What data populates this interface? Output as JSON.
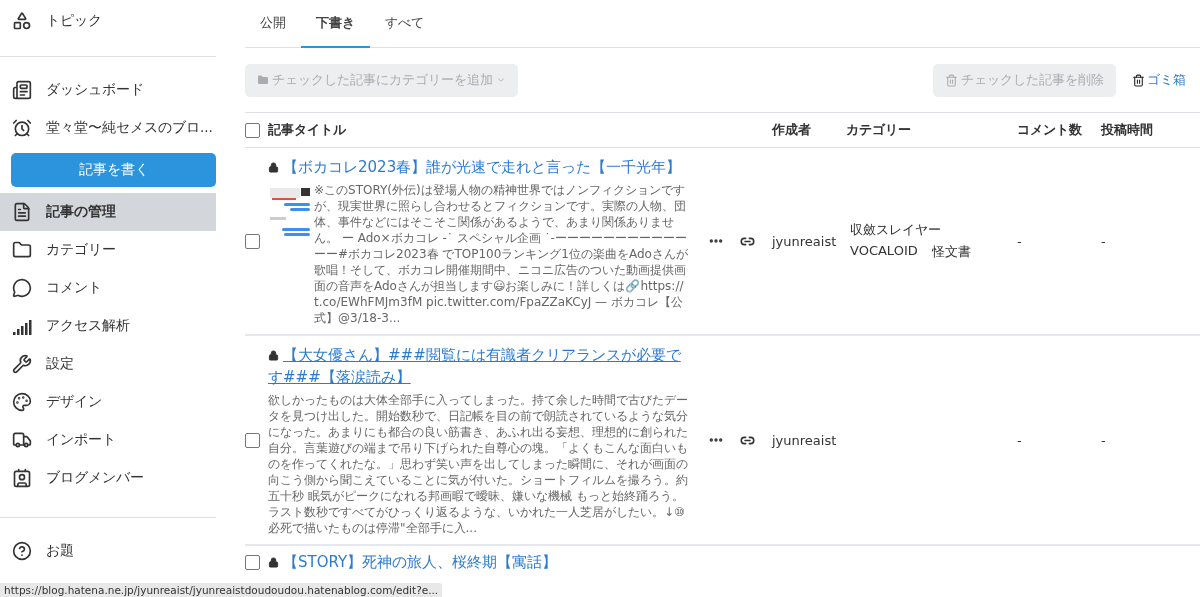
{
  "sidebar": {
    "top_items": [
      {
        "label": "トピック",
        "selected": false
      }
    ],
    "items": [
      {
        "label": "ダッシュボード",
        "selected": false
      },
      {
        "label": "堂々堂〜純セメスのブロ...",
        "selected": false
      }
    ],
    "write_button": "記事を書く",
    "manage_items": [
      {
        "label": "記事の管理",
        "selected": true
      },
      {
        "label": "カテゴリー",
        "selected": false
      },
      {
        "label": "コメント",
        "selected": false
      },
      {
        "label": "アクセス解析",
        "selected": false
      },
      {
        "label": "設定",
        "selected": false
      },
      {
        "label": "デザイン",
        "selected": false
      },
      {
        "label": "インポート",
        "selected": false
      },
      {
        "label": "ブログメンバー",
        "selected": false
      }
    ],
    "bottom_items": [
      {
        "label": "お題",
        "selected": false
      }
    ]
  },
  "tabs": [
    {
      "label": "公開",
      "selected": false
    },
    {
      "label": "下書き",
      "selected": true
    },
    {
      "label": "すべて",
      "selected": false
    }
  ],
  "toolbar": {
    "add_category": {
      "label": "チェックした記事にカテゴリーを追加",
      "disabled": true
    },
    "delete": {
      "label": "チェックした記事を削除",
      "disabled": true
    },
    "trash": "ゴミ箱"
  },
  "table": {
    "select_all": {
      "checked": false
    },
    "columns": [
      "記事タイトル",
      "作成者",
      "カテゴリー",
      "コメント数",
      "投稿時間"
    ],
    "rows": [
      {
        "checked": false,
        "locked": true,
        "hovered": false,
        "title": "【ボカコレ2023春】誰が光速で走れと言った【一千光年】",
        "excerpt": "※このSTORY(外伝)は登場人物の精神世界ではノンフィクションですが、現実世界に照らし合わせるとフィクションです。実際の人物、団体、事件などにはそこそこ関係があるようで、あまり関係ありません。 ー Ado×ボカコレ -˙ スペシャル企画 ˙-ーーーーーーーーーーーーー#ボカコレ2023春 でTOP100ランキング1位の楽曲をAdoさんが歌唱！そして、ボカコレ開催期間中、ニコニ広告のついた動画提供画面の音声をAdoさんが担当します😃お楽しみに！詳しくは🔗https://t.co/EWhFMJm3fM pic.twitter.com/FpaZZaKCyJ — ボカコレ【公式】@3/18-3...",
        "author": "jyunreaist",
        "categories": [
          "収斂スレイヤー",
          "VOCALOID",
          "怪文書"
        ],
        "comments": "-",
        "posted": "-"
      },
      {
        "checked": false,
        "locked": true,
        "hovered": true,
        "title": "【大女優さん】###閲覧には有識者クリアランスが必要です###【落涙読み】",
        "excerpt": "欲しかったものは大体全部手に入ってしまった。持て余した時間で古びたデータを見つけ出した。開始数秒で、日記帳を目の前で朗読されているような気分になった。あまりにも都合の良い筋書き、あふれ出る妄想、理想的に創られた自分。言葉遊びの端まで吊り下げられた自尊心の塊。「よくもこんな面白いものを作ってくれたな。」思わず笑い声を出してしまった瞬間に、それが画面の向こう側から聞こえていることに気が付いた。ショートフィルムを撮ろう。約五十秒 眠気がピークになれる邦画暇で曖昧、嫌いな機械 もっと始終踊ろう。ラスト数秒ですべてがひっくり返るような、いかれた一人芝居がしたい。↓⑩必死で描いたものは停滞\"全部手に入...",
        "author": "jyunreaist",
        "categories": [],
        "comments": "-",
        "posted": "-"
      },
      {
        "checked": false,
        "locked": true,
        "hovered": false,
        "title": "【STORY】死神の旅人、桜終期【寓話】"
      }
    ]
  },
  "status_bar": "https://blog.hatena.ne.jp/jyunreaist/jyunreaistdoudoudou.hatenablog.com/edit?e..."
}
